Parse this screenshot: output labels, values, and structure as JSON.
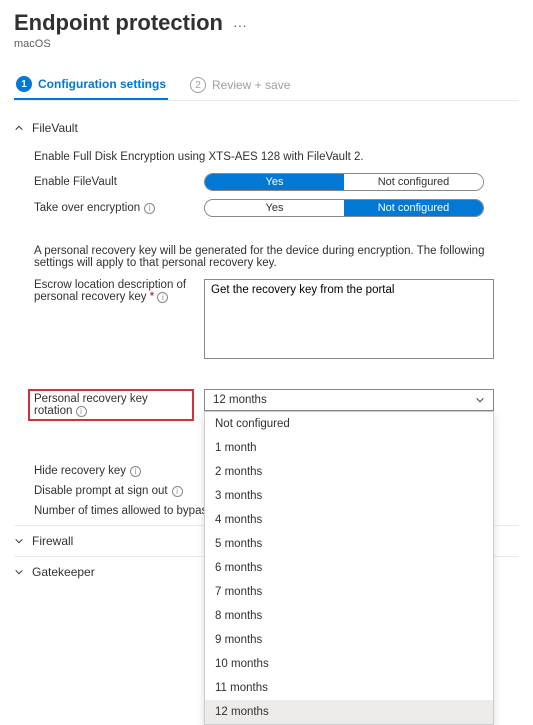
{
  "header": {
    "title": "Endpoint protection",
    "subtitle": "macOS"
  },
  "tabs": {
    "config": {
      "num": "1",
      "label": "Configuration settings"
    },
    "review": {
      "num": "2",
      "label": "Review + save"
    }
  },
  "filevault": {
    "title": "FileVault",
    "desc": "Enable Full Disk Encryption using XTS-AES 128 with FileVault 2.",
    "enable_label": "Enable FileVault",
    "takeover_label": "Take over encryption",
    "key_note": "A personal recovery key will be generated for the device during encryption. The following settings will apply to that personal recovery key.",
    "escrow_label": "Escrow location description of personal recovery key",
    "escrow_value": "Get the recovery key from the portal",
    "rotation_label": "Personal recovery key rotation",
    "rotation_value": "12 months",
    "hide_label": "Hide recovery key",
    "disable_prompt_label": "Disable prompt at sign out",
    "bypass_label": "Number of times allowed to bypass"
  },
  "toggle": {
    "yes": "Yes",
    "not_configured": "Not configured"
  },
  "dropdown": {
    "options": [
      "Not configured",
      "1 month",
      "2 months",
      "3 months",
      "4 months",
      "5 months",
      "6 months",
      "7 months",
      "8 months",
      "9 months",
      "10 months",
      "11 months",
      "12 months"
    ]
  },
  "sections": {
    "firewall": "Firewall",
    "gatekeeper": "Gatekeeper"
  }
}
